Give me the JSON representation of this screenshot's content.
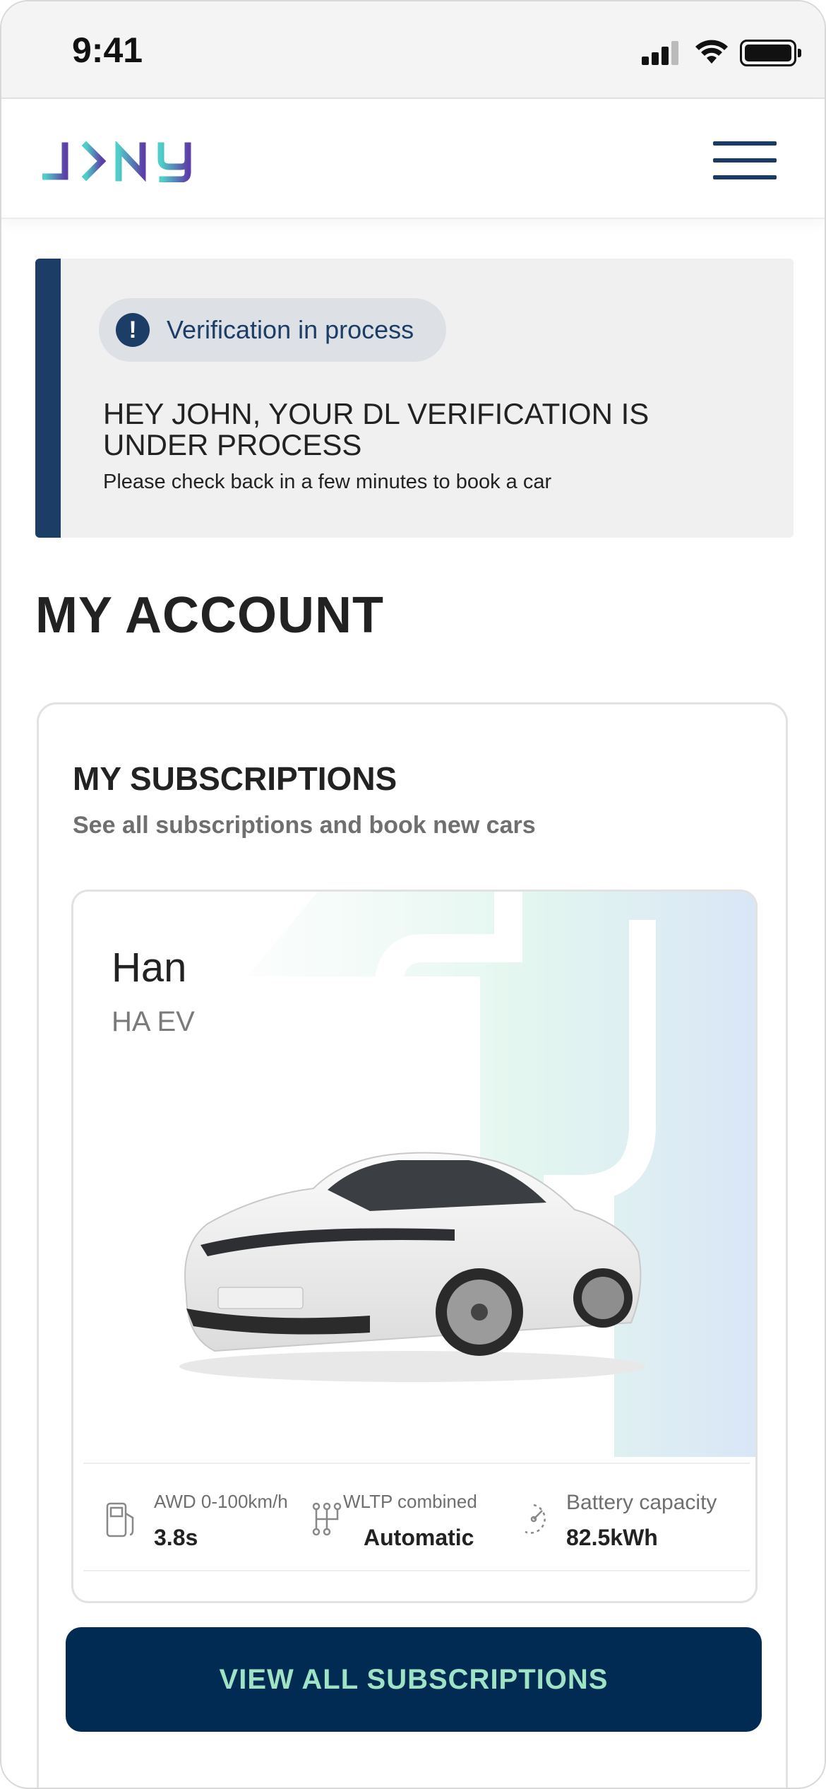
{
  "status_bar": {
    "time": "9:41",
    "icons": [
      "cellular-signal-icon",
      "wifi-icon",
      "battery-icon"
    ]
  },
  "header": {
    "logo_text": "J>NY",
    "menu_icon": "hamburger-menu-icon",
    "colors": {
      "logo_start": "#4fcfc8",
      "logo_end": "#5c3fa8",
      "menu": "#1a3c63"
    }
  },
  "banner": {
    "status_label": "Verification in process",
    "status_icon": "alert-circle-icon",
    "title": "HEY JOHN, YOUR DL VERIFICATION IS UNDER PROCESS",
    "subtitle": "Please check back in a few minutes to book a car",
    "accent_color": "#1b3d66"
  },
  "page": {
    "title": "MY ACCOUNT"
  },
  "subscriptions": {
    "title": "MY SUBSCRIPTIONS",
    "description": "See all subscriptions and book new cars",
    "car": {
      "name": "Han",
      "model": "HA EV",
      "specs": [
        {
          "icon": "fuel-pump-icon",
          "label": "AWD 0-100km/h",
          "value": "3.8s"
        },
        {
          "icon": "gearbox-icon",
          "label": "WLTP combined",
          "value": "Automatic"
        },
        {
          "icon": "battery-gauge-icon",
          "label": "Battery capacity",
          "value": "82.5kWh"
        }
      ]
    },
    "button_label": "VIEW ALL SUBSCRIPTIONS",
    "button_color": "#022b53",
    "button_text_color": "#9ee3c6"
  }
}
